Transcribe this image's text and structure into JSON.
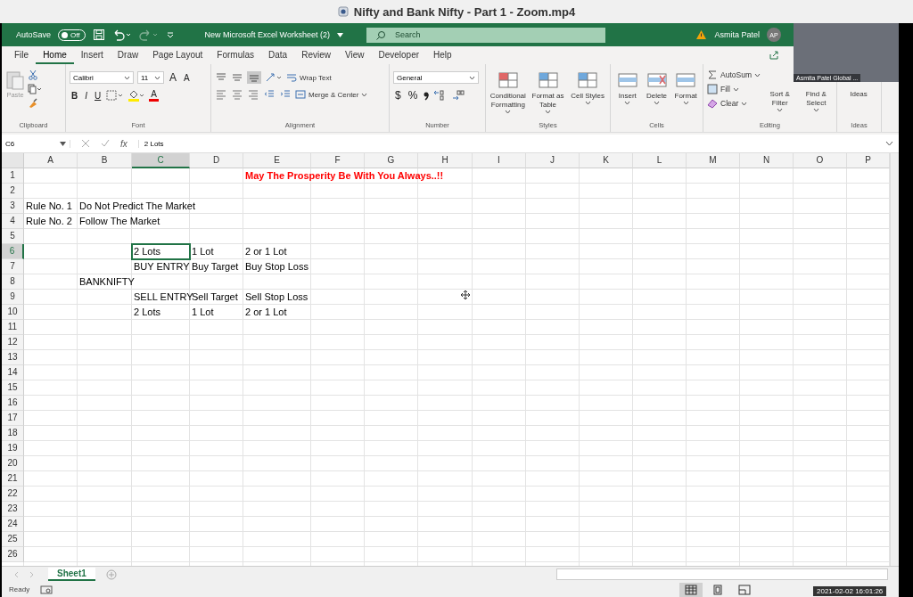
{
  "zoom_window": {
    "title": "Nifty and Bank Nifty - Part 1 - Zoom.mp4"
  },
  "excel_title_bar": {
    "autosave_label": "AutoSave",
    "autosave_on": false,
    "autosave_state": "Off",
    "file_title": "New Microsoft Excel Worksheet (2)",
    "search_placeholder": "Search",
    "user_name": "Asmita Patel",
    "user_initials": "AP"
  },
  "menu_tabs": [
    {
      "label": "File",
      "selected": false
    },
    {
      "label": "Home",
      "selected": true
    },
    {
      "label": "Insert",
      "selected": false
    },
    {
      "label": "Draw",
      "selected": false
    },
    {
      "label": "Page Layout",
      "selected": false
    },
    {
      "label": "Formulas",
      "selected": false
    },
    {
      "label": "Data",
      "selected": false
    },
    {
      "label": "Review",
      "selected": false
    },
    {
      "label": "View",
      "selected": false
    },
    {
      "label": "Developer",
      "selected": false
    },
    {
      "label": "Help",
      "selected": false
    }
  ],
  "ribbon": {
    "clipboard": {
      "name": "Clipboard",
      "paste": "Paste"
    },
    "font": {
      "name": "Font",
      "font_name": "Calibri",
      "font_size": "11",
      "grow": "A",
      "shrink": "A",
      "bold": "B",
      "italic": "I",
      "underline": "U",
      "font_color": "A"
    },
    "alignment": {
      "name": "Alignment",
      "wrap_text": "Wrap Text",
      "merge": "Merge & Center"
    },
    "number": {
      "name": "Number",
      "format": "General",
      "currency": "$",
      "percent": "%"
    },
    "styles": {
      "name": "Styles",
      "buttons": [
        "Conditional Formatting",
        "Format as Table",
        "Cell Styles"
      ]
    },
    "cells": {
      "name": "Cells",
      "buttons": [
        "Insert",
        "Delete",
        "Format"
      ]
    },
    "editing": {
      "name": "Editing",
      "small": [
        "AutoSum",
        "Fill",
        "Clear"
      ],
      "large": [
        "Sort & Filter",
        "Find & Select"
      ]
    },
    "ideas": {
      "name": "Ideas",
      "button": "Ideas"
    }
  },
  "formula_bar": {
    "name_box": "C6",
    "fx": "fx",
    "value": "2 Lots"
  },
  "columns": [
    {
      "label": "A",
      "selected": false
    },
    {
      "label": "B",
      "selected": false
    },
    {
      "label": "C",
      "selected": true
    },
    {
      "label": "D",
      "selected": false
    },
    {
      "label": "E",
      "selected": false
    },
    {
      "label": "F",
      "selected": false
    },
    {
      "label": "G",
      "selected": false
    },
    {
      "label": "H",
      "selected": false
    },
    {
      "label": "I",
      "selected": false
    },
    {
      "label": "J",
      "selected": false
    },
    {
      "label": "K",
      "selected": false
    },
    {
      "label": "L",
      "selected": false
    },
    {
      "label": "M",
      "selected": false
    },
    {
      "label": "N",
      "selected": false
    },
    {
      "label": "O",
      "selected": false
    },
    {
      "label": "P",
      "selected": false
    }
  ],
  "rows": [
    {
      "number": "1",
      "selected": false,
      "cells": {
        "E": {
          "text": "May The Prosperity Be With You Always..!!",
          "color": "#ff0000",
          "bold": true,
          "selected": false
        }
      }
    },
    {
      "number": "2",
      "selected": false,
      "cells": {}
    },
    {
      "number": "3",
      "selected": false,
      "cells": {
        "A": {
          "text": "Rule No. 1",
          "selected": false
        },
        "B": {
          "text": "Do Not Predict The Market",
          "selected": false
        }
      }
    },
    {
      "number": "4",
      "selected": false,
      "cells": {
        "A": {
          "text": "Rule No. 2",
          "selected": false
        },
        "B": {
          "text": "Follow The Market",
          "selected": false
        }
      }
    },
    {
      "number": "5",
      "selected": false,
      "cells": {}
    },
    {
      "number": "6",
      "selected": true,
      "cells": {
        "C": {
          "text": "2 Lots",
          "selected": true
        },
        "D": {
          "text": "1 Lot",
          "selected": false
        },
        "E": {
          "text": "2 or 1 Lot",
          "selected": false
        }
      }
    },
    {
      "number": "7",
      "selected": false,
      "cells": {
        "C": {
          "text": "BUY ENTRY",
          "selected": false
        },
        "D": {
          "text": "Buy Target",
          "selected": false
        },
        "E": {
          "text": "Buy Stop Loss",
          "selected": false
        }
      }
    },
    {
      "number": "8",
      "selected": false,
      "cells": {
        "B": {
          "text": "BANKNIFTY",
          "selected": false
        }
      }
    },
    {
      "number": "9",
      "selected": false,
      "cells": {
        "C": {
          "text": "SELL ENTRY",
          "selected": false
        },
        "D": {
          "text": "Sell Target",
          "selected": false
        },
        "E": {
          "text": "Sell Stop Loss",
          "selected": false
        }
      }
    },
    {
      "number": "10",
      "selected": false,
      "cells": {
        "C": {
          "text": "2 Lots",
          "selected": false
        },
        "D": {
          "text": "1 Lot",
          "selected": false
        },
        "E": {
          "text": "2 or 1 Lot",
          "selected": false
        }
      }
    },
    {
      "number": "11",
      "selected": false,
      "cells": {}
    },
    {
      "number": "12",
      "selected": false,
      "cells": {}
    },
    {
      "number": "13",
      "selected": false,
      "cells": {}
    },
    {
      "number": "14",
      "selected": false,
      "cells": {}
    },
    {
      "number": "15",
      "selected": false,
      "cells": {}
    },
    {
      "number": "16",
      "selected": false,
      "cells": {}
    },
    {
      "number": "17",
      "selected": false,
      "cells": {}
    },
    {
      "number": "18",
      "selected": false,
      "cells": {}
    },
    {
      "number": "19",
      "selected": false,
      "cells": {}
    },
    {
      "number": "20",
      "selected": false,
      "cells": {}
    },
    {
      "number": "21",
      "selected": false,
      "cells": {}
    },
    {
      "number": "22",
      "selected": false,
      "cells": {}
    },
    {
      "number": "23",
      "selected": false,
      "cells": {}
    },
    {
      "number": "24",
      "selected": false,
      "cells": {}
    },
    {
      "number": "25",
      "selected": false,
      "cells": {}
    },
    {
      "number": "26",
      "selected": false,
      "cells": {}
    }
  ],
  "sheet_tabs": [
    {
      "label": "Sheet1",
      "selected": true
    }
  ],
  "status_bar": {
    "status": "Ready",
    "views": [
      {
        "kind": "normal",
        "selected": true
      },
      {
        "kind": "page-layout",
        "selected": false
      },
      {
        "kind": "page-break",
        "selected": false
      }
    ]
  },
  "video": {
    "participant_label": "Asmita Patel Global ...",
    "timestamp": "2021-02-02 16:01:26"
  }
}
